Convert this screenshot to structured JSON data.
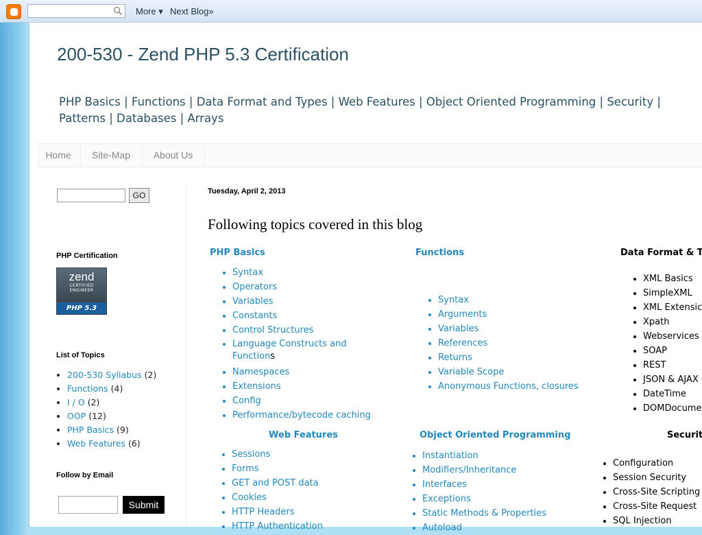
{
  "navbar": {
    "more_label": "More",
    "more_arrow": "▾",
    "next_blog_label": "Next Blog»"
  },
  "blog": {
    "title": "200-530 - Zend PHP 5.3 Certification",
    "topnav_line1": "PHP Basics | Functions | Data Format and Types | Web Features | Object Oriented Programming | Security |",
    "topnav_line2": "Patterns | Databases | Arrays"
  },
  "tabs": [
    "Home",
    "Site-Map",
    "About Us"
  ],
  "sidebar": {
    "go_label": "GO",
    "cert_heading": "PHP Certification",
    "badge": {
      "line1": "zend",
      "line2": "CERTIFIED",
      "line3": "ENGINEER",
      "line4": "PHP 5.3"
    },
    "topics_heading": "List of Topics",
    "topics": [
      {
        "label": "200-530 Syllabus",
        "count": "(2)"
      },
      {
        "label": "Functions",
        "count": "(4)"
      },
      {
        "label": "I / O",
        "count": "(2)"
      },
      {
        "label": "OOP",
        "count": "(12)"
      },
      {
        "label": "PHP Basics",
        "count": "(9)"
      },
      {
        "label": "Web Features",
        "count": "(6)"
      }
    ],
    "email_heading": "Follow by Email",
    "submit_label": "Submit"
  },
  "post": {
    "date": "Tuesday, April 2, 2013",
    "title": "Following topics covered in this blog",
    "php_basics": {
      "heading": "PHP Basics",
      "items": [
        "Syntax",
        "Operators",
        "Variables",
        "Constants",
        "Control Structures",
        "Language Constructs and Function",
        "Namespaces",
        "Extensions",
        "Config",
        "Performance/bytecode caching"
      ],
      "lang_suffix": "s"
    },
    "functions": {
      "heading": "Functions",
      "items": [
        "Syntax",
        "Arguments",
        "Variables",
        "References",
        "Returns",
        "Variable Scope",
        "Anonymous Functions, closures"
      ]
    },
    "data_format": {
      "heading": "Data Format & T",
      "items": [
        "XML Basics",
        "SimpleXML",
        "XML Extensic",
        "Xpath",
        "Webservices",
        "SOAP",
        "REST",
        "JSON & AJAX",
        "DateTime",
        "DOMDocumer"
      ]
    },
    "web_features": {
      "heading": "Web Features",
      "items": [
        "Sessions",
        "Forms",
        "GET and POST data",
        "Cookies",
        "HTTP Headers",
        "HTTP Authentication"
      ]
    },
    "oop": {
      "heading": "Object Oriented Programming",
      "items": [
        "Instantiation",
        "Modifiers/Inheritance",
        "Interfaces",
        "Exceptions",
        "Static Methods & Properties",
        "Autoload"
      ]
    },
    "security": {
      "heading": "Securit",
      "items": [
        "Configuration",
        "Session Security",
        "Cross-Site Scripting",
        "Cross-Site Request",
        "SQL Injection"
      ]
    }
  }
}
